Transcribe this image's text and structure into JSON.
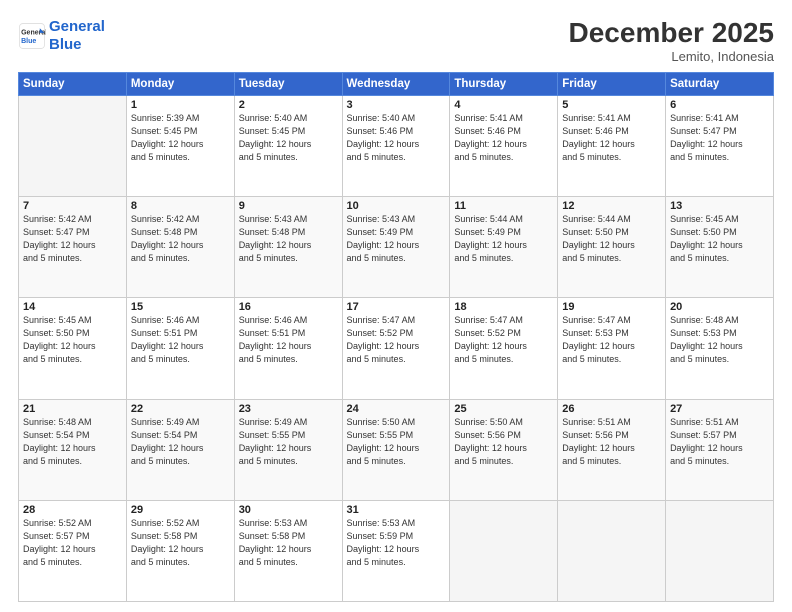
{
  "logo": {
    "line1": "General",
    "line2": "Blue"
  },
  "title": "December 2025",
  "location": "Lemito, Indonesia",
  "weekdays": [
    "Sunday",
    "Monday",
    "Tuesday",
    "Wednesday",
    "Thursday",
    "Friday",
    "Saturday"
  ],
  "weeks": [
    [
      null,
      {
        "day": "1",
        "sunrise": "5:39 AM",
        "sunset": "5:45 PM",
        "daylight": "12 hours and 5 minutes."
      },
      {
        "day": "2",
        "sunrise": "5:40 AM",
        "sunset": "5:45 PM",
        "daylight": "12 hours and 5 minutes."
      },
      {
        "day": "3",
        "sunrise": "5:40 AM",
        "sunset": "5:46 PM",
        "daylight": "12 hours and 5 minutes."
      },
      {
        "day": "4",
        "sunrise": "5:41 AM",
        "sunset": "5:46 PM",
        "daylight": "12 hours and 5 minutes."
      },
      {
        "day": "5",
        "sunrise": "5:41 AM",
        "sunset": "5:46 PM",
        "daylight": "12 hours and 5 minutes."
      },
      {
        "day": "6",
        "sunrise": "5:41 AM",
        "sunset": "5:47 PM",
        "daylight": "12 hours and 5 minutes."
      }
    ],
    [
      {
        "day": "7",
        "sunrise": "5:42 AM",
        "sunset": "5:47 PM",
        "daylight": "12 hours and 5 minutes."
      },
      {
        "day": "8",
        "sunrise": "5:42 AM",
        "sunset": "5:48 PM",
        "daylight": "12 hours and 5 minutes."
      },
      {
        "day": "9",
        "sunrise": "5:43 AM",
        "sunset": "5:48 PM",
        "daylight": "12 hours and 5 minutes."
      },
      {
        "day": "10",
        "sunrise": "5:43 AM",
        "sunset": "5:49 PM",
        "daylight": "12 hours and 5 minutes."
      },
      {
        "day": "11",
        "sunrise": "5:44 AM",
        "sunset": "5:49 PM",
        "daylight": "12 hours and 5 minutes."
      },
      {
        "day": "12",
        "sunrise": "5:44 AM",
        "sunset": "5:50 PM",
        "daylight": "12 hours and 5 minutes."
      },
      {
        "day": "13",
        "sunrise": "5:45 AM",
        "sunset": "5:50 PM",
        "daylight": "12 hours and 5 minutes."
      }
    ],
    [
      {
        "day": "14",
        "sunrise": "5:45 AM",
        "sunset": "5:50 PM",
        "daylight": "12 hours and 5 minutes."
      },
      {
        "day": "15",
        "sunrise": "5:46 AM",
        "sunset": "5:51 PM",
        "daylight": "12 hours and 5 minutes."
      },
      {
        "day": "16",
        "sunrise": "5:46 AM",
        "sunset": "5:51 PM",
        "daylight": "12 hours and 5 minutes."
      },
      {
        "day": "17",
        "sunrise": "5:47 AM",
        "sunset": "5:52 PM",
        "daylight": "12 hours and 5 minutes."
      },
      {
        "day": "18",
        "sunrise": "5:47 AM",
        "sunset": "5:52 PM",
        "daylight": "12 hours and 5 minutes."
      },
      {
        "day": "19",
        "sunrise": "5:47 AM",
        "sunset": "5:53 PM",
        "daylight": "12 hours and 5 minutes."
      },
      {
        "day": "20",
        "sunrise": "5:48 AM",
        "sunset": "5:53 PM",
        "daylight": "12 hours and 5 minutes."
      }
    ],
    [
      {
        "day": "21",
        "sunrise": "5:48 AM",
        "sunset": "5:54 PM",
        "daylight": "12 hours and 5 minutes."
      },
      {
        "day": "22",
        "sunrise": "5:49 AM",
        "sunset": "5:54 PM",
        "daylight": "12 hours and 5 minutes."
      },
      {
        "day": "23",
        "sunrise": "5:49 AM",
        "sunset": "5:55 PM",
        "daylight": "12 hours and 5 minutes."
      },
      {
        "day": "24",
        "sunrise": "5:50 AM",
        "sunset": "5:55 PM",
        "daylight": "12 hours and 5 minutes."
      },
      {
        "day": "25",
        "sunrise": "5:50 AM",
        "sunset": "5:56 PM",
        "daylight": "12 hours and 5 minutes."
      },
      {
        "day": "26",
        "sunrise": "5:51 AM",
        "sunset": "5:56 PM",
        "daylight": "12 hours and 5 minutes."
      },
      {
        "day": "27",
        "sunrise": "5:51 AM",
        "sunset": "5:57 PM",
        "daylight": "12 hours and 5 minutes."
      }
    ],
    [
      {
        "day": "28",
        "sunrise": "5:52 AM",
        "sunset": "5:57 PM",
        "daylight": "12 hours and 5 minutes."
      },
      {
        "day": "29",
        "sunrise": "5:52 AM",
        "sunset": "5:58 PM",
        "daylight": "12 hours and 5 minutes."
      },
      {
        "day": "30",
        "sunrise": "5:53 AM",
        "sunset": "5:58 PM",
        "daylight": "12 hours and 5 minutes."
      },
      {
        "day": "31",
        "sunrise": "5:53 AM",
        "sunset": "5:59 PM",
        "daylight": "12 hours and 5 minutes."
      },
      null,
      null,
      null
    ]
  ],
  "labels": {
    "sunrise_prefix": "Sunrise: ",
    "sunset_prefix": "Sunset: ",
    "daylight_prefix": "Daylight: "
  }
}
